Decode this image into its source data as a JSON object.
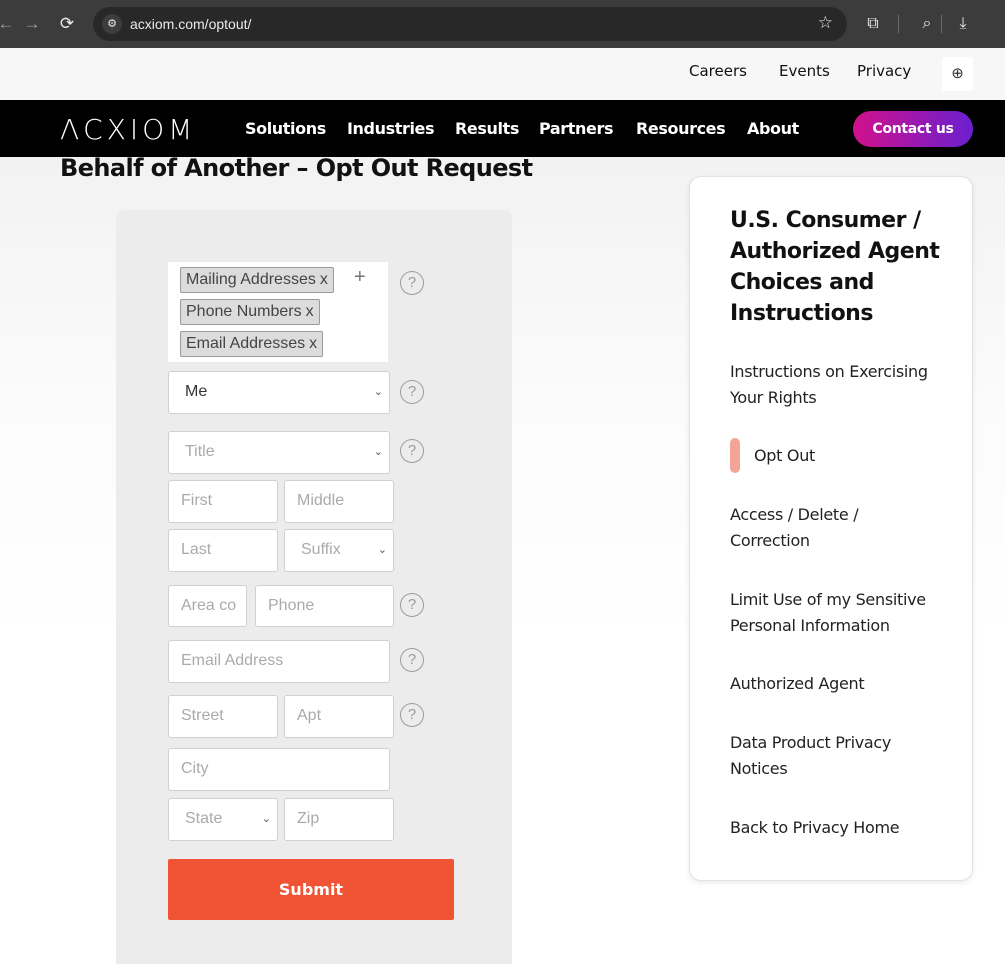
{
  "browser": {
    "url": "acxiom.com/optout/",
    "back_icon": "←",
    "forward_icon": "→",
    "reload_icon": "⟳",
    "site_icon": "⚙",
    "star_icon": "☆",
    "extensions_icon": "⧉",
    "search_tab_icon": "⌕",
    "download_icon": "⤓"
  },
  "utility_nav": {
    "items": [
      "Careers",
      "Events",
      "Privacy"
    ],
    "globe_icon": "⊕"
  },
  "main_nav": {
    "logo": "ΛCXIOM",
    "items": [
      "Solutions",
      "Industries",
      "Results",
      "Partners",
      "Resources",
      "About"
    ],
    "contact_label": "Contact us",
    "contact_gradient": [
      "#d1118a",
      "#6a1fd0"
    ]
  },
  "page": {
    "title": "Behalf of Another – Opt Out Request"
  },
  "form": {
    "tags": [
      {
        "label": "Mailing Addresses",
        "remove": "x"
      },
      {
        "label": "Phone Numbers",
        "remove": "x"
      },
      {
        "label": "Email Addresses",
        "remove": "x"
      }
    ],
    "tag_add": "+",
    "help_icon": "?",
    "requester_select": "Me",
    "title_select": "Title",
    "first_placeholder": "First",
    "middle_placeholder": "Middle",
    "last_placeholder": "Last",
    "suffix_select": "Suffix",
    "area_code_placeholder": "Area co",
    "phone_placeholder": "Phone",
    "email_placeholder": "Email Address",
    "street_placeholder": "Street",
    "apt_placeholder": "Apt",
    "city_placeholder": "City",
    "state_select": "State",
    "zip_placeholder": "Zip",
    "submit_label": "Submit",
    "submit_color": "#f05435",
    "chevron": "⌄"
  },
  "sidebar": {
    "title": "U.S. Consumer / Authorized Agent Choices and Instructions",
    "links": [
      "Instructions on Exercising Your Rights",
      "Opt Out",
      "Access / Delete / Correction",
      "Limit Use of my Sensitive Personal Information",
      "Authorized Agent",
      "Data Product Privacy Notices",
      "Back to Privacy Home"
    ],
    "active_color": "#f3a496"
  }
}
